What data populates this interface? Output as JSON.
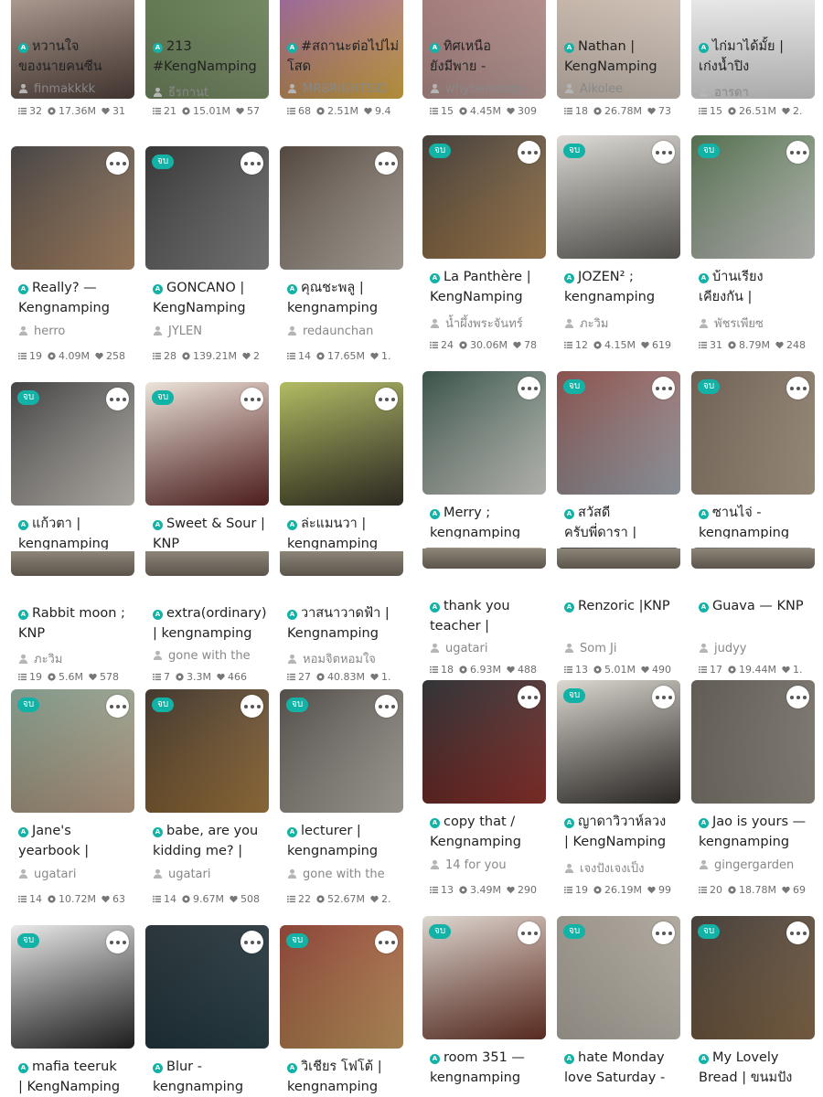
{
  "left_panel": {
    "top_row": [
      {
        "title": [
          "หวานใจ",
          "ของนายคนซีน"
        ],
        "author": "finmakkkk",
        "chapters": "32",
        "views": "17.36M",
        "votes": "31",
        "colors": [
          "#b8a397",
          "#5a4740"
        ]
      },
      {
        "title": [
          "213",
          "#KengNamping"
        ],
        "author": "ธีรกานt",
        "chapters": "21",
        "views": "15.01M",
        "votes": "57",
        "colors": [
          "#4f6a3d",
          "#8ea57a"
        ]
      },
      {
        "title": [
          "#สถานะต่อไปไม่",
          "โสด"
        ],
        "author": "MRBRIGHTSID",
        "chapters": "68",
        "views": "2.51M",
        "votes": "9.4",
        "colors": [
          "#8c4fa0",
          "#f2c14e"
        ]
      }
    ],
    "rows": [
      [
        {
          "badge": "",
          "title": [
            "Really? —",
            "Kengnamping"
          ],
          "author": "herro",
          "chapters": "19",
          "views": "4.09M",
          "votes": "258",
          "colors": [
            "#2e2b2b",
            "#c9a07a"
          ]
        },
        {
          "badge": "จบ",
          "title": [
            "GONCANO |",
            "KengNamping"
          ],
          "author": "JYLEN",
          "chapters": "28",
          "views": "139.21M",
          "votes": "2",
          "colors": [
            "#1b1b1b",
            "#9a9a9a"
          ]
        },
        {
          "badge": "",
          "title": [
            "คุณชะพลู |",
            "kengnamping"
          ],
          "author": "redaunchan",
          "chapters": "14",
          "views": "17.65M",
          "votes": "1.",
          "colors": [
            "#3b2e25",
            "#d8cfc3"
          ]
        }
      ],
      [
        {
          "badge": "จบ",
          "title": [
            "แก้วตา |",
            "kengnamping"
          ],
          "author": "",
          "chapters": "",
          "views": "",
          "votes": "",
          "colors": [
            "#2a2a2a",
            "#e8e2da"
          ]
        },
        {
          "badge": "จบ",
          "title": [
            "Sweet & Sour |",
            "KNP"
          ],
          "author": "",
          "chapters": "",
          "views": "",
          "votes": "",
          "colors": [
            "#e9e2d6",
            "#6c2a2a"
          ]
        },
        {
          "badge": "",
          "title": [
            "ล่ะแมนวา |",
            "kengnamping"
          ],
          "author": "",
          "chapters": "",
          "views": "",
          "votes": "",
          "colors": [
            "#a8b34c",
            "#3d3a2f"
          ]
        }
      ],
      [
        {
          "badge": "",
          "title": [
            "Rabbit moon ;",
            "KNP"
          ],
          "author": "ภะวิม",
          "chapters": "19",
          "views": "5.6M",
          "votes": "578",
          "colors": [
            "#d9d0b4",
            "#f1ebd8"
          ]
        },
        {
          "badge": "",
          "title": [
            "extra(ordinary)",
            "| kengnamping"
          ],
          "author": "gone with the",
          "chapters": "7",
          "views": "3.3M",
          "votes": "466",
          "colors": [
            "#8d8a82",
            "#d2cfc8"
          ]
        },
        {
          "badge": "",
          "title": [
            "วาสนาวาดฟ้า |",
            "Kengnamping"
          ],
          "author": "หอมจิตหอมใจ",
          "chapters": "27",
          "views": "40.83M",
          "votes": "1.",
          "colors": [
            "#1c1f1c",
            "#6a6a5a"
          ]
        }
      ],
      [
        {
          "badge": "จบ",
          "title": [
            "Jane's",
            "yearbook |"
          ],
          "author": "ugatari",
          "chapters": "14",
          "views": "10.72M",
          "votes": "63",
          "colors": [
            "#6f8a7a",
            "#d7b69a"
          ]
        },
        {
          "badge": "จบ",
          "title": [
            "babe, are you",
            "kidding me? |"
          ],
          "author": "ugatari",
          "chapters": "14",
          "views": "9.67M",
          "votes": "508",
          "colors": [
            "#2a1e14",
            "#b98a4a"
          ]
        },
        {
          "badge": "จบ",
          "title": [
            "lecturer |",
            "kengnamping"
          ],
          "author": "gone with the",
          "chapters": "22",
          "views": "52.67M",
          "votes": "2.",
          "colors": [
            "#3a3530",
            "#cfcac0"
          ]
        }
      ],
      [
        {
          "badge": "จบ",
          "title": [
            "mafia teeruk",
            "| KengNamping"
          ],
          "author": "",
          "chapters": "",
          "views": "",
          "votes": "",
          "colors": [
            "#e8e8e8",
            "#2a2a2a"
          ]
        },
        {
          "badge": "",
          "title": [
            "Blur -",
            "kengnamping"
          ],
          "author": "",
          "chapters": "",
          "views": "",
          "votes": "",
          "colors": [
            "#0e1a20",
            "#2f4a52"
          ]
        },
        {
          "badge": "จบ",
          "title": [
            "วิเชียร โฟโต้ |",
            "kengnamping"
          ],
          "author": "",
          "chapters": "",
          "views": "",
          "votes": "",
          "colors": [
            "#7a2a1c",
            "#e0b070"
          ]
        }
      ]
    ]
  },
  "right_panel": {
    "top_row": [
      {
        "title": [
          "ทิศเหนือ",
          "ยังมีพาย -"
        ],
        "author": "whybemoody",
        "chapters": "15",
        "views": "4.45M",
        "votes": "309",
        "colors": [
          "#9b6a6a",
          "#d6b5b0"
        ]
      },
      {
        "title": [
          "Nathan |",
          "KengNamping"
        ],
        "author": "Aikolee",
        "chapters": "18",
        "views": "26.78M",
        "votes": "73",
        "colors": [
          "#c7b3a4",
          "#e9ddd3"
        ]
      },
      {
        "title": [
          "ไก่มาได้มั้ย |",
          "เก่งน้ำปิง"
        ],
        "author": "อารดา",
        "chapters": "15",
        "views": "26.51M",
        "votes": "2.",
        "colors": [
          "#f5f5f5",
          "#ececec"
        ]
      }
    ],
    "rows": [
      [
        {
          "badge": "จบ",
          "title": [
            "La Panthère |",
            "KengNamping"
          ],
          "author": "น้ำผึ้งพระจันทร์",
          "chapters": "24",
          "views": "30.06M",
          "votes": "78",
          "colors": [
            "#2c2520",
            "#c79a62"
          ]
        },
        {
          "badge": "จบ",
          "title": [
            "JOZEN² ;",
            "kengnamping"
          ],
          "author": "ภะวิม",
          "chapters": "12",
          "views": "4.15M",
          "votes": "619",
          "colors": [
            "#d9d6d0",
            "#6d6a64"
          ]
        },
        {
          "badge": "จบ",
          "title": [
            "บ้านเรียง",
            "เคียงกัน |"
          ],
          "author": "พัชรเพียซ",
          "chapters": "31",
          "views": "8.79M",
          "votes": "248",
          "colors": [
            "#3b5a36",
            "#e9e9e5"
          ]
        }
      ],
      [
        {
          "badge": "",
          "title": [
            "Merry ;",
            "kengnamping"
          ],
          "author": "",
          "chapters": "",
          "views": "",
          "votes": "",
          "colors": [
            "#1e3b2f",
            "#f0f0ea"
          ]
        },
        {
          "badge": "จบ",
          "title": [
            "สวัสดี",
            "ครับพี่ดารา |"
          ],
          "author": "",
          "chapters": "",
          "views": "",
          "votes": "",
          "colors": [
            "#7a3a34",
            "#b9c2cc"
          ]
        },
        {
          "badge": "จบ",
          "title": [
            "ซานไจ่ -",
            "kengnamping"
          ],
          "author": "",
          "chapters": "",
          "views": "",
          "votes": "",
          "colors": [
            "#5a4a3c",
            "#c9b7a0"
          ]
        }
      ],
      [
        {
          "badge": "",
          "title": [
            "thank you",
            "teacher |"
          ],
          "author": "ugatari",
          "chapters": "18",
          "views": "6.93M",
          "votes": "488",
          "colors": [
            "#8a7a68",
            "#c5b8a6"
          ]
        },
        {
          "badge": "",
          "title": [
            "Renzoric |KNP",
            ""
          ],
          "author": "Som Ji",
          "chapters": "13",
          "views": "5.01M",
          "votes": "490",
          "colors": [
            "#2a2a2a",
            "#6a6a6a"
          ]
        },
        {
          "badge": "",
          "title": [
            "Guava — KNP",
            ""
          ],
          "author": "judyy",
          "chapters": "17",
          "views": "19.44M",
          "votes": "1.",
          "colors": [
            "#5a5550",
            "#a09a92"
          ]
        }
      ],
      [
        {
          "badge": "",
          "title": [
            "copy that /",
            "Kengnamping"
          ],
          "author": "14 for you",
          "chapters": "13",
          "views": "3.49M",
          "votes": "290",
          "colors": [
            "#15181c",
            "#a33a33"
          ]
        },
        {
          "badge": "จบ",
          "title": [
            "ญาดาวิวาห์ลวง",
            "| KengNamping"
          ],
          "author": "เจงปังเจงเป็ง",
          "chapters": "19",
          "views": "26.19M",
          "votes": "99",
          "colors": [
            "#d8d4cc",
            "#3a3632"
          ]
        },
        {
          "badge": "",
          "title": [
            "Jao is yours —",
            "kengnamping"
          ],
          "author": "gingergarden",
          "chapters": "20",
          "views": "18.78M",
          "votes": "69",
          "colors": [
            "#4a453e",
            "#a8a296"
          ]
        }
      ],
      [
        {
          "badge": "จบ",
          "title": [
            "room 351 —",
            "kengnamping"
          ],
          "author": "",
          "chapters": "",
          "views": "",
          "votes": "",
          "colors": [
            "#d7d2cb",
            "#7a3b2c"
          ]
        },
        {
          "badge": "จบ",
          "title": [
            "hate Monday",
            "love Saturday -"
          ],
          "author": "",
          "chapters": "",
          "views": "",
          "votes": "",
          "colors": [
            "#8c857b",
            "#d9d2c6"
          ]
        },
        {
          "badge": "จบ",
          "title": [
            "My Lovely",
            "Bread | ขนมปัง"
          ],
          "author": "",
          "chapters": "",
          "views": "",
          "votes": "",
          "colors": [
            "#2e2620",
            "#9a7a56"
          ]
        }
      ]
    ]
  }
}
